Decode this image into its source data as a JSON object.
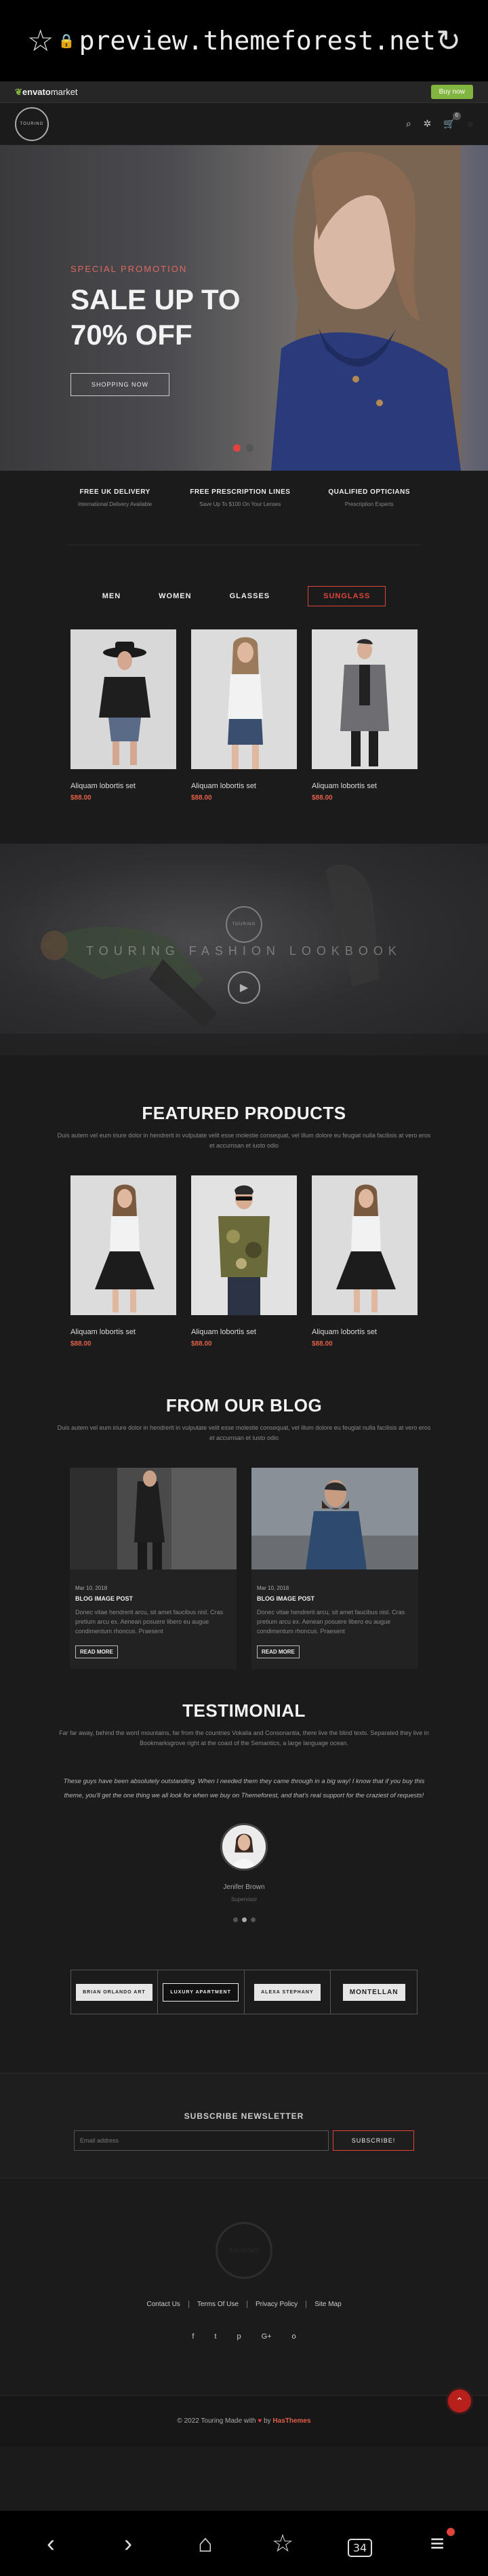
{
  "browser": {
    "url": "preview.themeforest.net",
    "tab_count": "34"
  },
  "envato": {
    "logo": "envato",
    "logo_suffix": "market",
    "buy_label": "Buy now"
  },
  "header": {
    "logo_text": "TOURING",
    "cart_count": "0"
  },
  "hero": {
    "promo": "SPECIAL PROMOTION",
    "title": "SALE UP TO 70% OFF",
    "button": "SHOPPING NOW"
  },
  "features": [
    {
      "title": "FREE UK DELIVERY",
      "sub": "International Delivery Available"
    },
    {
      "title": "FREE PRESCRIPTION LINES",
      "sub": "Save Up To $100 On Your Lenses"
    },
    {
      "title": "QUALIFIED OPTICIANS",
      "sub": "Prescription Experts"
    }
  ],
  "tabs": [
    "MEN",
    "WOMEN",
    "GLASSES",
    "SUNGLASS"
  ],
  "products": [
    {
      "name": "Aliquam lobortis set",
      "price": "$88.00"
    },
    {
      "name": "Aliquam lobortis set",
      "price": "$88.00"
    },
    {
      "name": "Aliquam lobortis set",
      "price": "$88.00"
    }
  ],
  "lookbook": {
    "title": "TOURING FASHION LOOKBOOK",
    "logo_text": "TOURING"
  },
  "featured": {
    "title": "FEATURED PRODUCTS",
    "desc": "Duis autem vel eum iriure dolor in hendrerit in vulputate velit esse molestie consequat, vel illum dolore eu feugiat nulla facilisis at vero eros et accumsan et iusto odio",
    "products": [
      {
        "name": "Aliquam lobortis set",
        "price": "$88.00"
      },
      {
        "name": "Aliquam lobortis set",
        "price": "$88.00"
      },
      {
        "name": "Aliquam lobortis set",
        "price": "$88.00"
      }
    ]
  },
  "blog": {
    "title": "FROM OUR BLOG",
    "desc": "Duis autem vel eum iriure dolor in hendrerit in vulputate velit esse molestie consequat, vel illum dolore eu feugiat nulla facilisis at vero eros et accumsan et iusto odio",
    "posts": [
      {
        "date": "Mar 10, 2018",
        "title": "BLOG IMAGE POST",
        "text": "Donec vitae hendrerit arcu, sit amet faucibus nisl. Cras pretium arcu ex. Aenean posuere libero eu augue condimentum rhoncus. Praesent",
        "more": "READ MORE"
      },
      {
        "date": "Mar 10, 2018",
        "title": "BLOG IMAGE POST",
        "text": "Donec vitae hendrerit arcu, sit amet faucibus nisl. Cras pretium arcu ex. Aenean posuere libero eu augue condimentum rhoncus. Praesent",
        "more": "READ MORE"
      }
    ]
  },
  "testimonial": {
    "title": "TESTIMONIAL",
    "desc": "Far far away, behind the word mountains, far from the countries Vokalia and Consonantia, there live the blind texts. Separated they live in Bookmarksgrove right at the coast of the Semantics, a large language ocean.",
    "quote": "These guys have been absolutely outstanding. When I needed them they came through in a big way! I know that if you buy this theme, you'll get the one thing we all look for when we buy on Themeforest, and that's real support for the craziest of requests!",
    "name": "Jenifer Brown",
    "role": "Supervisor"
  },
  "brands": [
    {
      "label": "BRIAN ORLANDO ART"
    },
    {
      "label": "LUXURY APARTMENT"
    },
    {
      "label": "ALEXA STEPHANY"
    },
    {
      "label": "MONTELLAN"
    }
  ],
  "newsletter": {
    "title": "SUBSCRIBE NEWSLETTER",
    "placeholder": "Email address",
    "button": "SUBSCRIBE!"
  },
  "footer": {
    "logo_text": "TOURING",
    "links": [
      "Contact Us",
      "Terms Of Use",
      "Privacy Policy",
      "Site Map"
    ],
    "socials": [
      "f",
      "t",
      "p",
      "G+",
      "o"
    ],
    "copyright_prefix": "© 2022 Touring Made with",
    "copyright_by": "by",
    "copyright_brand": "HasThemes"
  },
  "colors": {
    "accent": "#e0443c",
    "price": "#e06048",
    "envato_green": "#82b440",
    "background": "#1b1b1b"
  }
}
